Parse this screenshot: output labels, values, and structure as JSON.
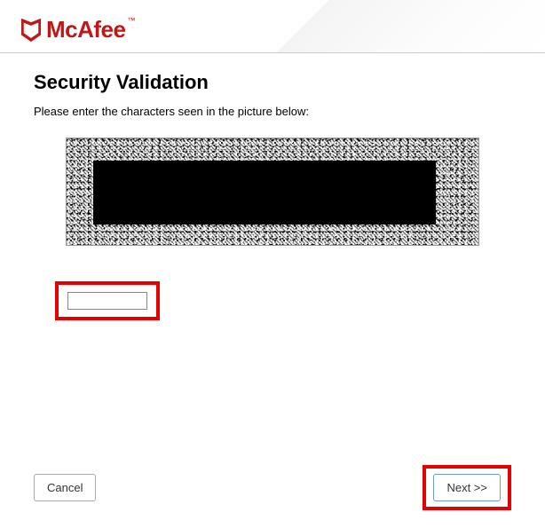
{
  "brand": {
    "name": "McAfee",
    "trademark": "™",
    "color": "#C01818"
  },
  "window": {
    "close_symbol": "✕"
  },
  "content": {
    "title": "Security Validation",
    "instruction": "Please enter the characters seen in the picture below:"
  },
  "form": {
    "captcha_value": ""
  },
  "buttons": {
    "cancel": "Cancel",
    "next": "Next >>"
  },
  "highlights": {
    "color": "#E60000"
  }
}
